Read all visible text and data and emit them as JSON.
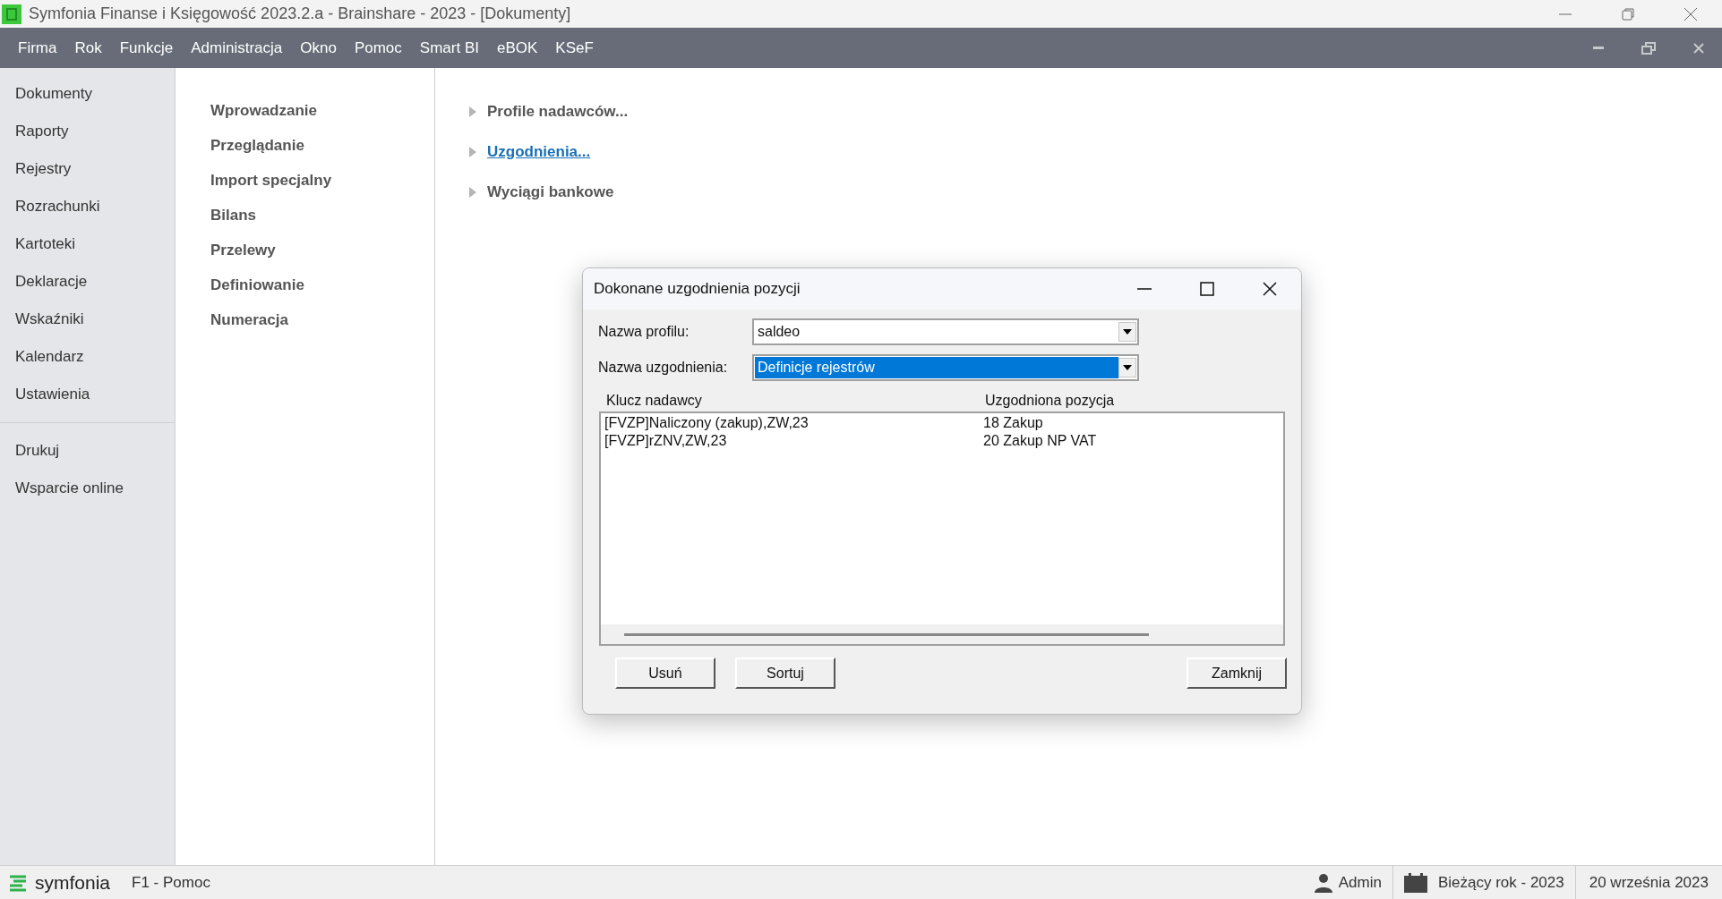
{
  "window": {
    "title": "Symfonia Finanse i Księgowość 2023.2.a - Brainshare - 2023 - [Dokumenty]"
  },
  "menu": [
    "Firma",
    "Rok",
    "Funkcje",
    "Administracja",
    "Okno",
    "Pomoc",
    "Smart BI",
    "eBOK",
    "KSeF"
  ],
  "sidebar": {
    "groups": [
      [
        "Dokumenty",
        "Raporty",
        "Rejestry",
        "Rozrachunki",
        "Kartoteki",
        "Deklaracje",
        "Wskaźniki",
        "Kalendarz",
        "Ustawienia"
      ],
      [
        "Drukuj",
        "Wsparcie online"
      ]
    ]
  },
  "actions": [
    "Wprowadzanie",
    "Przeglądanie",
    "Import specjalny",
    "Bilans",
    "Przelewy",
    "Definiowanie",
    "Numeracja"
  ],
  "subactions": [
    {
      "label": "Profile nadawców...",
      "selected": false
    },
    {
      "label": "Uzgodnienia...",
      "selected": true
    },
    {
      "label": "Wyciągi bankowe",
      "selected": false
    }
  ],
  "dialog": {
    "title": "Dokonane uzgodnienia pozycji",
    "fields": [
      {
        "label": "Nazwa profilu:",
        "value": "saldeo",
        "selected": false
      },
      {
        "label": "Nazwa uzgodnienia:",
        "value": "Definicje rejestrów",
        "selected": true
      }
    ],
    "table": {
      "columns": [
        "Klucz nadawcy",
        "Uzgodniona pozycja"
      ],
      "rows": [
        [
          "[FVZP]Naliczony (zakup),ZW,23",
          "18 Zakup"
        ],
        [
          "[FVZP]rZNV,ZW,23",
          "20 Zakup NP VAT"
        ]
      ]
    },
    "buttons": [
      "Usuń",
      "Sortuj",
      "Zamknij"
    ]
  },
  "status_bar": {
    "logo": "symfonia",
    "help": "F1 - Pomoc",
    "user": "Admin",
    "year": "Bieżący rok - 2023",
    "date": "20 września 2023"
  }
}
